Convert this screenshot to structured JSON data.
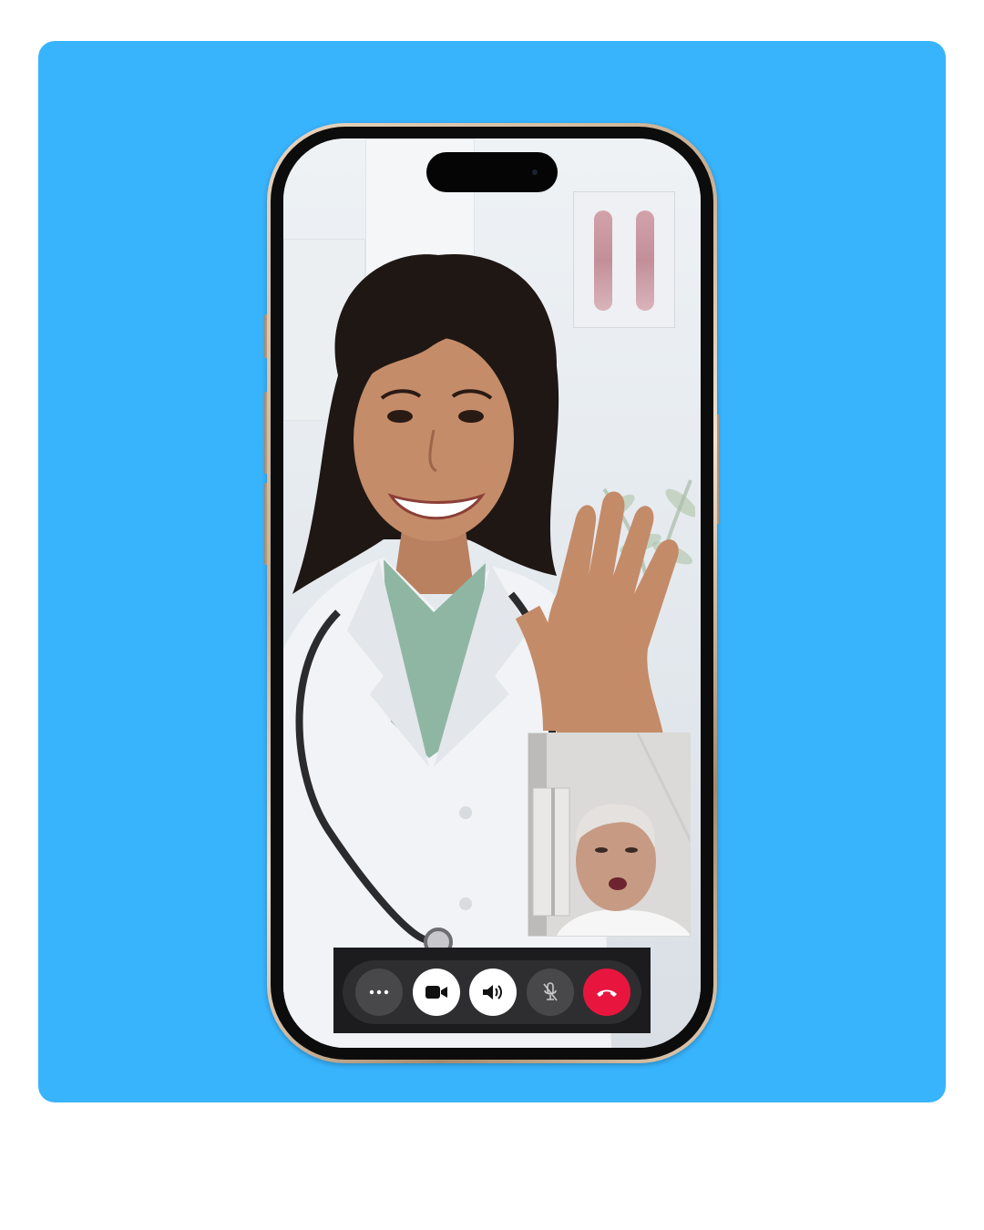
{
  "colors": {
    "background_card": "#38b4fd",
    "end_call": "#e8163f",
    "control_dark": "#48484a",
    "control_light": "#ffffff"
  },
  "call": {
    "remote_participant": "doctor",
    "self_view": "patient"
  },
  "controls": [
    {
      "name": "more-options",
      "icon": "ellipsis-icon",
      "style": "dark"
    },
    {
      "name": "camera-toggle",
      "icon": "video-camera-icon",
      "style": "light"
    },
    {
      "name": "speaker-toggle",
      "icon": "speaker-icon",
      "style": "light"
    },
    {
      "name": "mute-toggle",
      "icon": "mic-off-icon",
      "style": "dark"
    },
    {
      "name": "end-call",
      "icon": "hang-up-icon",
      "style": "end"
    }
  ]
}
